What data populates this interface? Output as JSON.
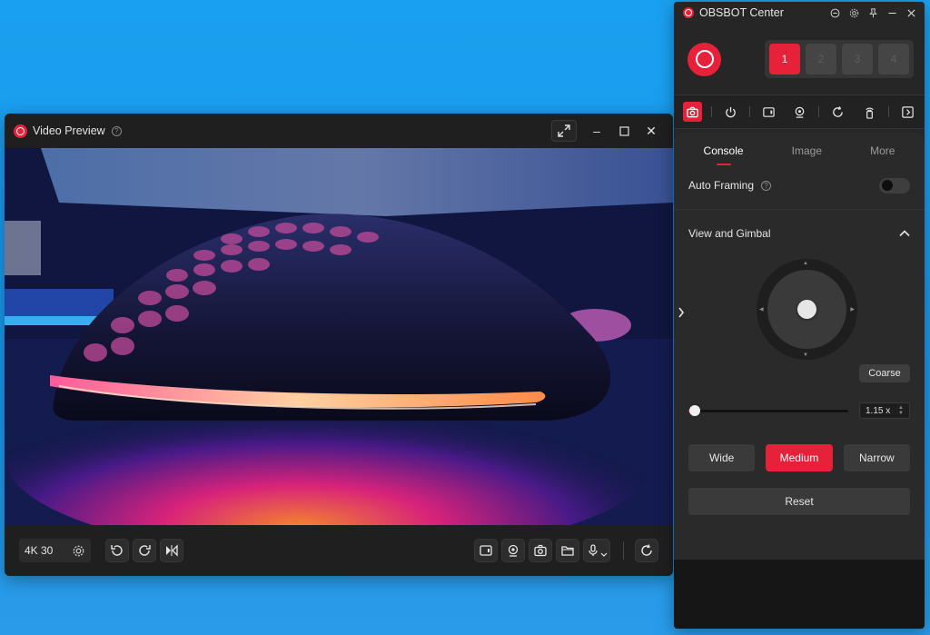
{
  "preview": {
    "title": "Video Preview",
    "help_glyph": "?",
    "resolution": "4K 30",
    "window_controls": {
      "expand": "expand-icon",
      "minimize": "–",
      "maximize": "☐",
      "close": "✕"
    }
  },
  "center": {
    "title": "OBSBOT Center",
    "title_icons": [
      "record-icon",
      "gear-icon",
      "pin-icon",
      "minimize-icon",
      "close-icon"
    ],
    "slots": [
      "1",
      "2",
      "3",
      "4"
    ],
    "active_slot": "1",
    "tabs": [
      "Console",
      "Image",
      "More"
    ],
    "active_tab": "Console",
    "auto_framing_label": "Auto Framing",
    "auto_framing_on": false,
    "section_title": "View and Gimbal",
    "coarse_label": "Coarse",
    "zoom_value": "1.15 x",
    "zoom_fraction": 0.04,
    "fov_buttons": [
      "Wide",
      "Medium",
      "Narrow"
    ],
    "active_fov": "Medium",
    "reset_label": "Reset"
  },
  "colors": {
    "accent": "#e8213a",
    "background": "#1aa0f0",
    "panel": "#262626"
  }
}
